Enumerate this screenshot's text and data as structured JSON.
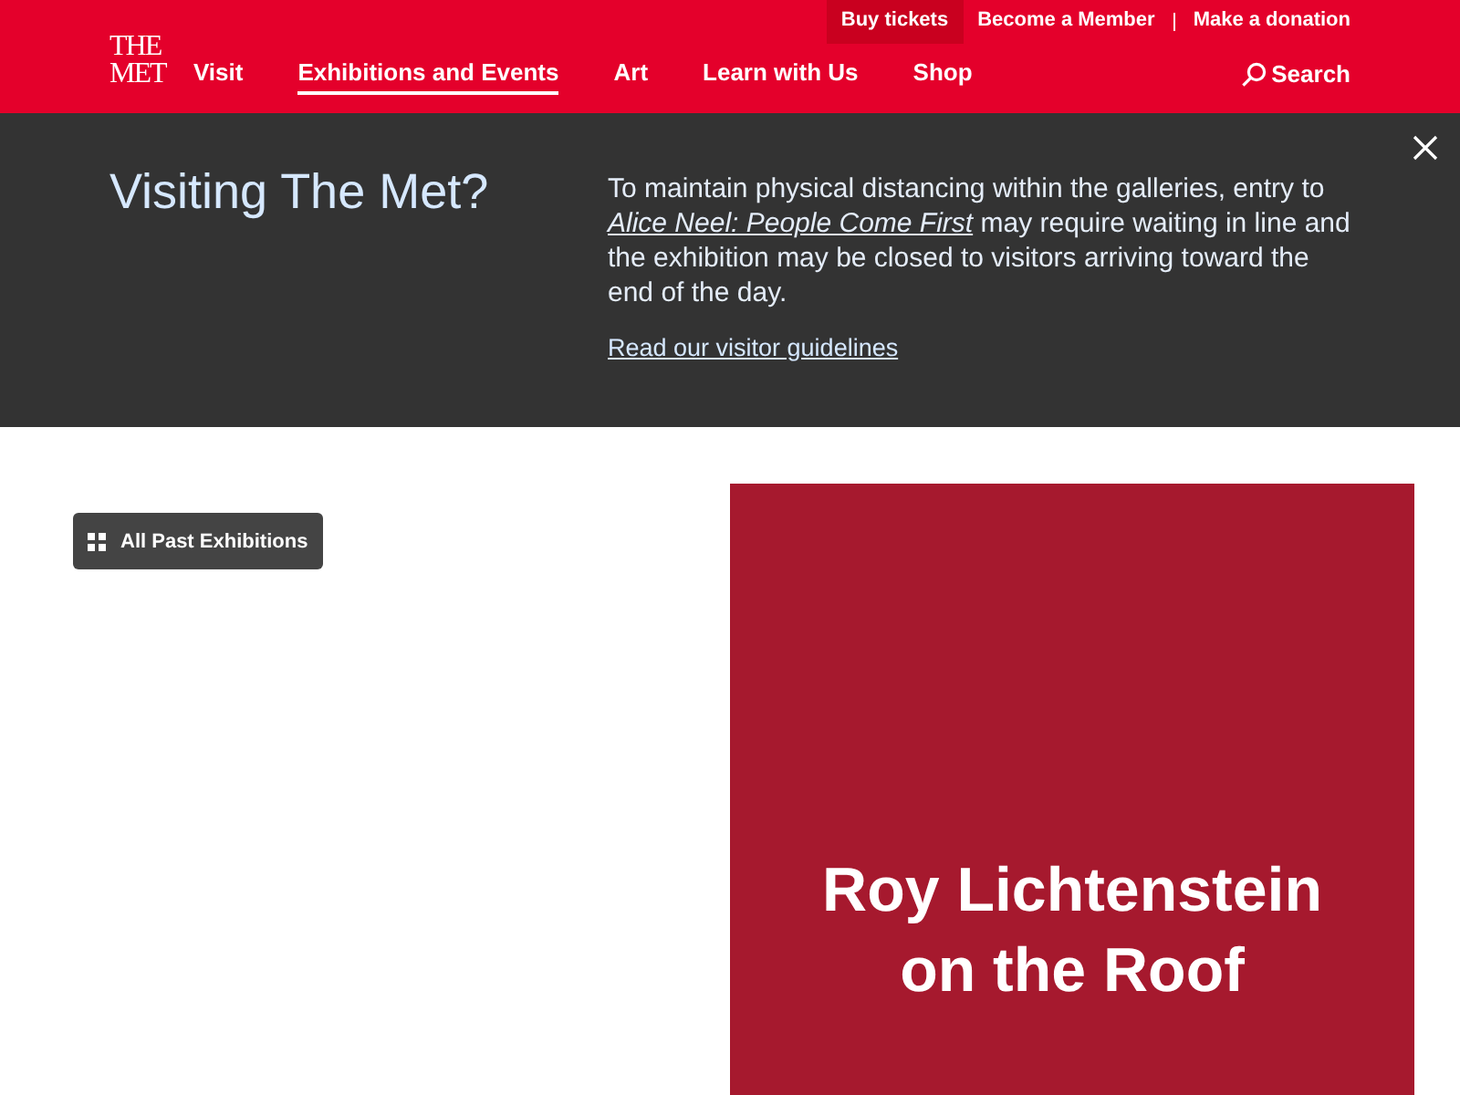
{
  "header": {
    "logo": [
      "THE",
      "MET"
    ],
    "top_links": [
      {
        "label": "Buy tickets",
        "selected": true
      },
      {
        "label": "Become a Member",
        "selected": false
      },
      {
        "label": "Make a donation",
        "selected": false
      }
    ],
    "nav": [
      {
        "label": "Visit",
        "selected": false
      },
      {
        "label": "Exhibitions and Events",
        "selected": true
      },
      {
        "label": "Art",
        "selected": false
      },
      {
        "label": "Learn with Us",
        "selected": false
      },
      {
        "label": "Shop",
        "selected": false
      }
    ],
    "search": "Search"
  },
  "banner": {
    "title": "Visiting The Met?",
    "text_before": "To maintain physical distancing within the galleries, entry to",
    "link": "Alice Neel: People Come First",
    "text_after": "may require waiting in line and the exhibition may be closed to visitors arriving toward the end of the day.",
    "guidelines_link": "Read our visitor guidelines"
  },
  "past_button": "All Past Exhibitions",
  "feature": {
    "title": "Roy Lichtenstein on the Roof"
  }
}
